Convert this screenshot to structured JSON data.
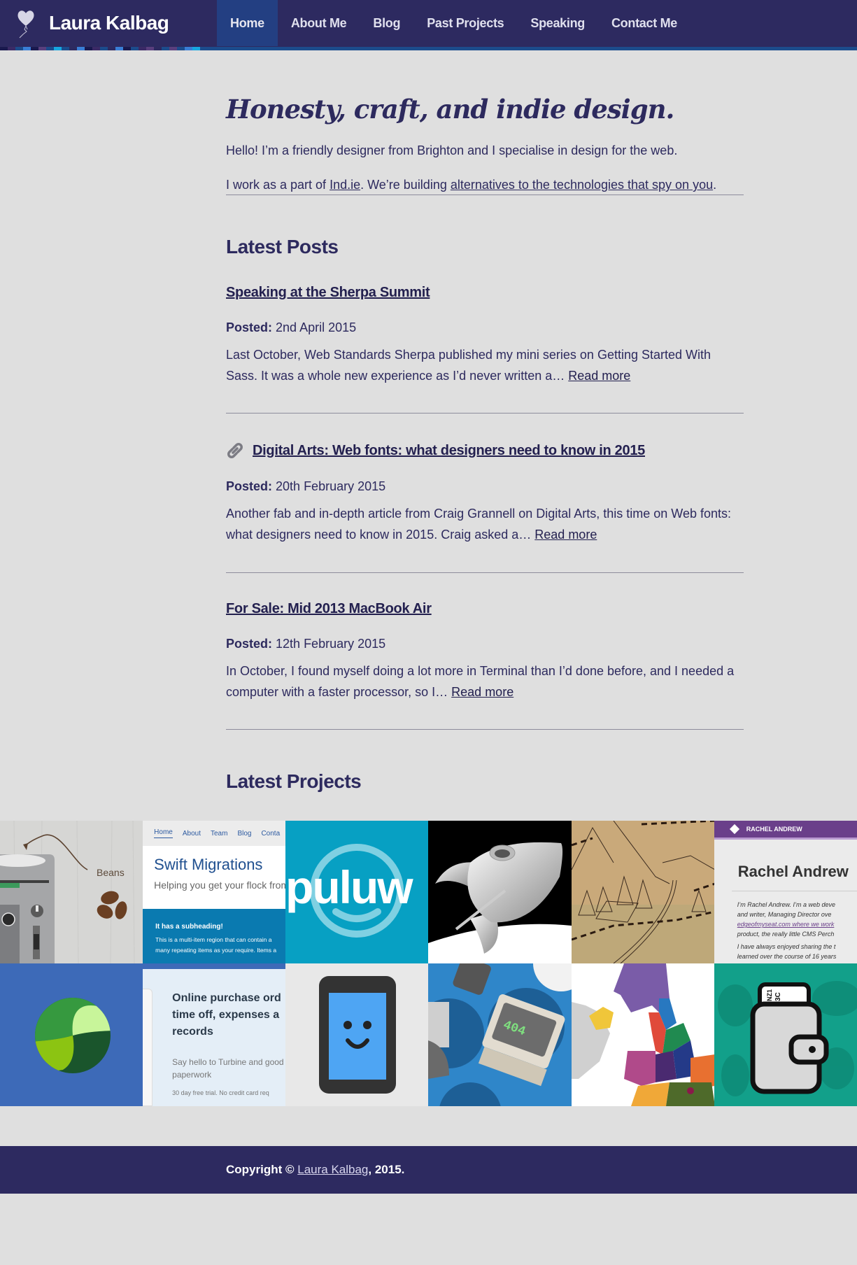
{
  "header": {
    "site_name": "Laura Kalbag",
    "nav": [
      {
        "label": "Home",
        "active": true
      },
      {
        "label": "About Me",
        "active": false
      },
      {
        "label": "Blog",
        "active": false
      },
      {
        "label": "Past Projects",
        "active": false
      },
      {
        "label": "Speaking",
        "active": false
      },
      {
        "label": "Contact Me",
        "active": false
      }
    ],
    "stripe_colors": [
      "#1a1a4e",
      "#3b2a66",
      "#1c4c8c",
      "#3a7fd6",
      "#1a1a4e",
      "#5a3f7e",
      "#1c4c8c",
      "#17a7e0",
      "#1c4c8c",
      "#2d2a60",
      "#3a7fd6",
      "#1a1a4e",
      "#3b2a66",
      "#1c4c8c",
      "#2d2a60",
      "#3a7fd6",
      "#1a1a4e",
      "#1c4c8c",
      "#3b2a66",
      "#5a3f7e",
      "#2d2a60",
      "#1c4c8c",
      "#5a3f7e",
      "#1c4c8c",
      "#3a7fd6",
      "#17a7e0"
    ]
  },
  "intro": {
    "tagline": "Honesty, craft, and indie design.",
    "p1": "Hello! I’m a friendly designer from Brighton and I specialise in design for the web.",
    "p2_before": "I work as a part of ",
    "p2_link1": "Ind.ie",
    "p2_middle": ". We’re building ",
    "p2_link2": "alternatives to the technologies that spy on you",
    "p2_after": "."
  },
  "latest_posts": {
    "title": "Latest Posts",
    "posted_label": "Posted:",
    "read_more": "Read more",
    "posts": [
      {
        "title": "Speaking at the Sherpa Summit",
        "date": "2nd April 2015",
        "excerpt": "Last October, Web Standards Sherpa published my mini series on Getting Started With Sass. It was a whole new experience as I’d never written a…",
        "is_link_post": false
      },
      {
        "title": "Digital Arts: Web fonts: what designers need to know in 2015",
        "date": "20th February 2015",
        "excerpt": "Another fab and in-depth article from Craig Grannell on Digital Arts, this time on Web fonts: what designers need to know in 2015. Craig asked a…",
        "is_link_post": true
      },
      {
        "title": "For Sale: Mid 2013 MacBook Air",
        "date": "12th February 2015",
        "excerpt": "In October, I found myself doing a lot more in Terminal than I’d done before, and I needed a computer with a faster processor, so I…",
        "is_link_post": false
      }
    ]
  },
  "latest_projects": {
    "title": "Latest Projects",
    "tiles": [
      {
        "name": "coffee-machine-illustration",
        "label": "Beans"
      },
      {
        "name": "swift-migrations-screenshot",
        "nav": [
          "Home",
          "About",
          "Team",
          "Blog",
          "Conta"
        ],
        "heading": "Swift Migrations",
        "subheading": "Helping you get your flock from",
        "band_title": "It has a subheading!",
        "band_text1": "This is a multi-item region that can contain a",
        "band_text2": "many repeating items as your require. Items a"
      },
      {
        "name": "puluw-logo",
        "label": "puluw"
      },
      {
        "name": "rocket-illustration"
      },
      {
        "name": "hand-drawn-map-illustration"
      },
      {
        "name": "rachel-andrew-screenshot",
        "bar_label": "RACHEL ANDREW",
        "heading": "Rachel Andrew",
        "lines": [
          "I’m Rachel Andrew. I’m a web deve",
          "and writer, Managing Director ove",
          "edgeofmyseat.com where we work",
          "product, the really little CMS Perch",
          "I have always enjoyed sharing the t",
          "learned over the course of 16 years"
        ]
      },
      {
        "name": "green-sphere-logo"
      },
      {
        "name": "turbine-screenshot",
        "heading1": "Online purchase ord",
        "heading2": "time off, expenses a",
        "heading3": "records",
        "sub1": "Say hello to Turbine and good",
        "sub2": "paperwork",
        "note": "30 day free trial. No credit card req"
      },
      {
        "name": "smiling-phone-icon"
      },
      {
        "name": "404-computers-illustration",
        "screen_text": "404"
      },
      {
        "name": "uk-regions-map"
      },
      {
        "name": "wallet-app-icon",
        "ticket_text1": "NZ1",
        "ticket_text2": "3C"
      }
    ]
  },
  "footer": {
    "before": "Copyright © ",
    "link": "Laura Kalbag",
    "after": ", 2015."
  }
}
